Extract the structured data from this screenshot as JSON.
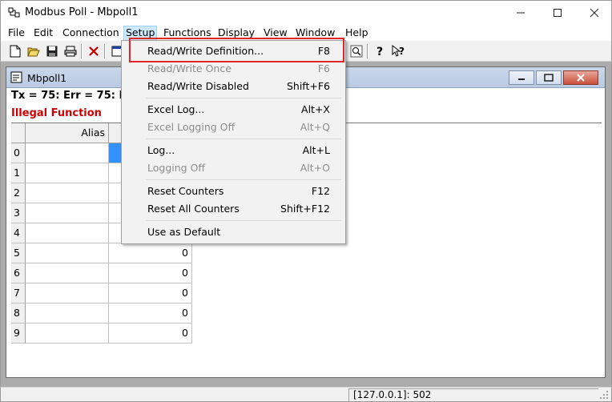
{
  "window": {
    "title": "Modbus Poll - Mbpoll1"
  },
  "menubar": [
    "File",
    "Edit",
    "Connection",
    "Setup",
    "Functions",
    "Display",
    "View",
    "Window",
    "Help"
  ],
  "child": {
    "title": "Mbpoll1",
    "status_line": "Tx = 75: Err = 75: ID =",
    "error_text": "Illegal Function"
  },
  "grid": {
    "alias_header": "Alias",
    "rows": [
      "0",
      "1",
      "2",
      "3",
      "4",
      "5",
      "6",
      "7",
      "8",
      "9"
    ],
    "values": [
      "",
      "",
      "",
      "",
      "",
      "0",
      "0",
      "0",
      "0",
      "0"
    ]
  },
  "setup_menu": {
    "items": [
      {
        "label": "Read/Write Definition...",
        "shortcut": "F8",
        "enabled": true
      },
      {
        "label": "Read/Write Once",
        "shortcut": "F6",
        "enabled": false
      },
      {
        "label": "Read/Write Disabled",
        "shortcut": "Shift+F6",
        "enabled": true
      },
      {
        "label": "Excel Log...",
        "shortcut": "Alt+X",
        "enabled": true
      },
      {
        "label": "Excel Logging Off",
        "shortcut": "Alt+Q",
        "enabled": false
      },
      {
        "label": "Log...",
        "shortcut": "Alt+L",
        "enabled": true
      },
      {
        "label": "Logging Off",
        "shortcut": "Alt+O",
        "enabled": false
      },
      {
        "label": "Reset Counters",
        "shortcut": "F12",
        "enabled": true
      },
      {
        "label": "Reset All Counters",
        "shortcut": "Shift+F12",
        "enabled": true
      },
      {
        "label": "Use as Default",
        "shortcut": "",
        "enabled": true
      }
    ]
  },
  "statusbar": {
    "connection": "[127.0.0.1]: 502"
  },
  "colors": {
    "error": "#d00000",
    "highlight": "#e0262b",
    "menu_active": "#cce8ff"
  },
  "icons": [
    "app-icon",
    "new-icon",
    "open-icon",
    "save-icon",
    "print-icon",
    "delete-icon",
    "window-icon",
    "sniff-icon",
    "help-icon",
    "context-help-icon"
  ]
}
